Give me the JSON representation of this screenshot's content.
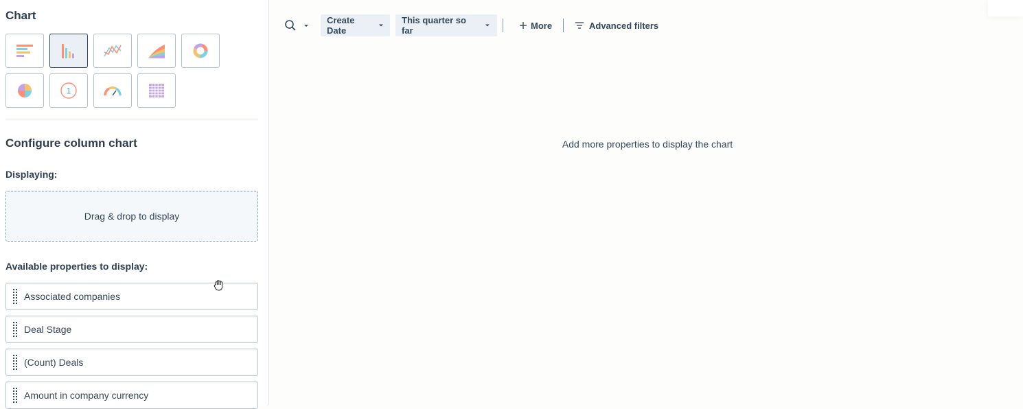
{
  "sidebar": {
    "chart_heading": "Chart",
    "chart_types": [
      {
        "name": "horizontal-bar",
        "icon": "horizontal-bar-chart-icon",
        "selected": false
      },
      {
        "name": "column",
        "icon": "column-chart-icon",
        "selected": true
      },
      {
        "name": "line",
        "icon": "line-chart-icon",
        "selected": false
      },
      {
        "name": "area",
        "icon": "area-chart-icon",
        "selected": false
      },
      {
        "name": "donut",
        "icon": "donut-chart-icon",
        "selected": false
      },
      {
        "name": "pie",
        "icon": "pie-chart-icon",
        "selected": false
      },
      {
        "name": "summary",
        "icon": "summary-number-icon",
        "selected": false,
        "glyph": "1"
      },
      {
        "name": "gauge",
        "icon": "gauge-chart-icon",
        "selected": false
      },
      {
        "name": "table",
        "icon": "table-chart-icon",
        "selected": false
      }
    ],
    "configure_heading": "Configure column chart",
    "displaying_label": "Displaying:",
    "dropzone_text": "Drag & drop to display",
    "available_label": "Available properties to display:",
    "properties": [
      "Associated companies",
      "Deal Stage",
      "(Count) Deals",
      "Amount in company currency"
    ]
  },
  "toolbar": {
    "search_icon": "search-icon",
    "create_date_label": "Create Date",
    "quarter_label": "This quarter so far",
    "more_label": "More",
    "advanced_filters_label": "Advanced filters"
  },
  "main": {
    "empty_message": "Add more properties to display the chart"
  },
  "colors": {
    "accent_orange": "#ff7a59",
    "border": "#b7c2cf",
    "text": "#33475b",
    "filter_bg": "#eaf0f6"
  }
}
